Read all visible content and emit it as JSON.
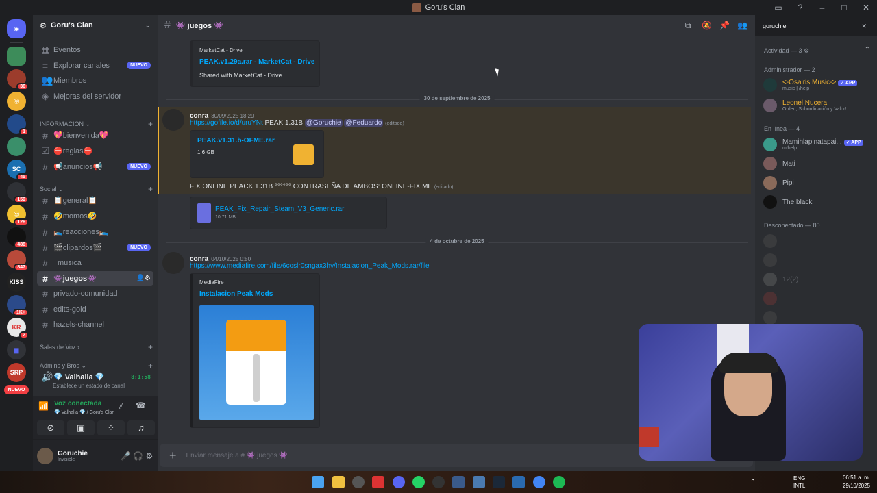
{
  "window": {
    "title": "Goru's Clan"
  },
  "guilds": {
    "badges": [
      "36",
      "1",
      "45",
      "159",
      "126",
      "488",
      "847",
      "1K+",
      "2"
    ],
    "new_label": "NUEVO"
  },
  "server": {
    "name": "Goru's Clan"
  },
  "nav": {
    "events": "Eventos",
    "explore": "Explorar canales",
    "explore_tag": "NUEVO",
    "members": "Miembros",
    "boosts": "Mejoras del servidor"
  },
  "categories": {
    "info": "INFORMACIÓN",
    "social": "Social",
    "voice": "Salas de Voz",
    "admins": "Admins y Bros"
  },
  "channels": [
    {
      "label": "💖bienvenida💖",
      "tag": ""
    },
    {
      "label": "⛔reglas⛔",
      "tag": ""
    },
    {
      "label": "📢anuncios📢",
      "tag": "NUEVO"
    },
    {
      "label": "📋general📋",
      "tag": ""
    },
    {
      "label": "🤣momos🤣",
      "tag": ""
    },
    {
      "label": "🛌reacciones🛌",
      "tag": ""
    },
    {
      "label": "🎬clipardos🎬",
      "tag": "NUEVO"
    },
    {
      "label": "musica",
      "tag": ""
    },
    {
      "label": "👾juegos👾",
      "tag": ""
    },
    {
      "label": "privado-comunidad",
      "tag": ""
    },
    {
      "label": "edits-gold",
      "tag": ""
    },
    {
      "label": "hazels-channel",
      "tag": ""
    }
  ],
  "voice_channel": {
    "name": "💎 Valhalla 💎",
    "timer": "8:1:58",
    "status": "Establece un estado de canal"
  },
  "voice_connected": {
    "title": "Voz conectada",
    "location": "💎 Valhalla 💎 / Goru's Clan"
  },
  "user": {
    "name": "Goruchie",
    "status": "Invisible"
  },
  "chat": {
    "channel": "👾 juegos 👾",
    "embed1": {
      "provider": "MarketCat - Drive",
      "title": "PEAK.v1.29a.rar - MarketCat - Drive",
      "desc": "Shared with MarketCat - Drive"
    },
    "date1": "30 de septiembre de 2025",
    "msg1": {
      "author": "conra",
      "time": "30/09/2025 18:29",
      "link": "https://gofile.io/d/uruYNt",
      "text": "PEAK 1.31B",
      "mention1": "@Goruchie",
      "mention2": "@Feduardo",
      "edited": "(editado)"
    },
    "file1": {
      "name": "PEAK.v1.31.b-OFME.rar",
      "size": "1.6 GB"
    },
    "msg2": {
      "text": "FIX ONLINE PEACK 1.31B °°°°°° CONTRASEÑA DE AMBOS: ONLINE-FIX.ME",
      "edited": "(editado)"
    },
    "file2": {
      "name": "PEAK_Fix_Repair_Steam_V3_Generic.rar",
      "size": "10.71 MB"
    },
    "date2": "4 de octubre de 2025",
    "msg3": {
      "author": "conra",
      "time": "04/10/2025 0:50",
      "link": "https://www.mediafire.com/file/6coslr0sngax3hv/Instalacion_Peak_Mods.rar/file"
    },
    "embed2": {
      "provider": "MediaFire",
      "title": "Instalacion Peak Mods"
    },
    "input_placeholder": "Enviar mensaje a # 👾 juegos 👾"
  },
  "search": {
    "value": "goruchie"
  },
  "members": {
    "activity": "Actividad — 3",
    "admin_header": "Administrador — 2",
    "admins": [
      {
        "name": "<-Osairis Music->",
        "sub": "music | /help",
        "app": "✓ APP"
      },
      {
        "name": "Leonel Nucera",
        "sub": "Orden, Subordinación y Valor!",
        "app": ""
      }
    ],
    "online_header": "En línea — 4",
    "online": [
      {
        "name": "Mamihlapinatapai...",
        "sub": "m!help",
        "app": "✓ APP"
      },
      {
        "name": "Mati",
        "sub": "",
        "app": ""
      },
      {
        "name": "Pipi",
        "sub": "",
        "app": ""
      },
      {
        "name": "The black",
        "sub": "",
        "app": ""
      }
    ],
    "offline_header": "Desconectado — 80",
    "offline_names": [
      "12(2)"
    ]
  },
  "taskbar": {
    "lang1": "ENG",
    "lang2": "INTL",
    "time": "06:51 a. m.",
    "date": "29/10/2025"
  }
}
